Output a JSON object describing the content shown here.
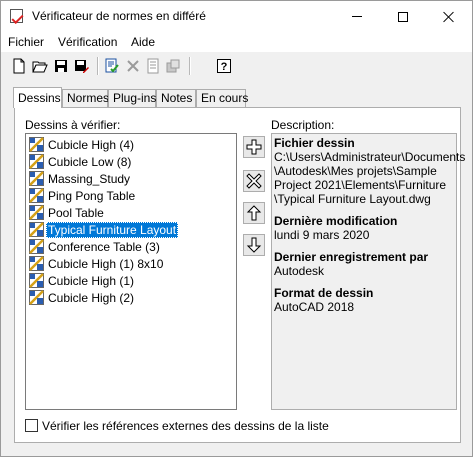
{
  "window": {
    "title": "Vérificateur de normes en différé"
  },
  "menu": [
    {
      "label": "Fichier"
    },
    {
      "label": "Vérification"
    },
    {
      "label": "Aide"
    }
  ],
  "toolbar": [
    {
      "icon": "new-file-icon"
    },
    {
      "icon": "open-folder-icon"
    },
    {
      "icon": "save-icon"
    },
    {
      "icon": "save-as-icon"
    },
    {
      "icon": "check-standards-icon"
    },
    {
      "icon": "delete-icon"
    },
    {
      "icon": "notes-icon"
    },
    {
      "icon": "plugins-icon"
    },
    {
      "icon": "help-icon"
    }
  ],
  "tabs": [
    {
      "label": "Dessins",
      "active": true
    },
    {
      "label": "Normes"
    },
    {
      "label": "Plug-ins"
    },
    {
      "label": "Notes"
    },
    {
      "label": "En cours"
    }
  ],
  "drawings": {
    "label": "Dessins à vérifier:",
    "items": [
      "Cubicle High (4)",
      "Cubicle Low (8)",
      "Massing_Study",
      "Ping Pong Table",
      "Pool Table",
      "Typical Furniture Layout",
      "Conference Table (3)",
      "Cubicle High (1) 8x10",
      "Cubicle High (1)",
      "Cubicle High (2)"
    ],
    "selected_index": 5
  },
  "side_buttons": [
    {
      "icon": "add-icon"
    },
    {
      "icon": "remove-icon"
    },
    {
      "icon": "move-up-icon"
    },
    {
      "icon": "move-down-icon"
    }
  ],
  "description": {
    "label": "Description:",
    "sections": [
      {
        "heading": "Fichier dessin",
        "lines": [
          "C:\\Users\\Administrateur\\Documents",
          "\\Autodesk\\Mes projets\\Sample",
          "Project 2021\\Elements\\Furniture",
          "\\Typical Furniture Layout.dwg"
        ]
      },
      {
        "heading": "Dernière modification",
        "lines": [
          "lundi 9 mars 2020"
        ]
      },
      {
        "heading": "Dernier enregistrement par",
        "lines": [
          "Autodesk"
        ]
      },
      {
        "heading": "Format de dessin",
        "lines": [
          "AutoCAD 2018"
        ]
      }
    ]
  },
  "xref_checkbox": {
    "label": "Vérifier les références externes des dessins de la liste",
    "checked": false
  }
}
